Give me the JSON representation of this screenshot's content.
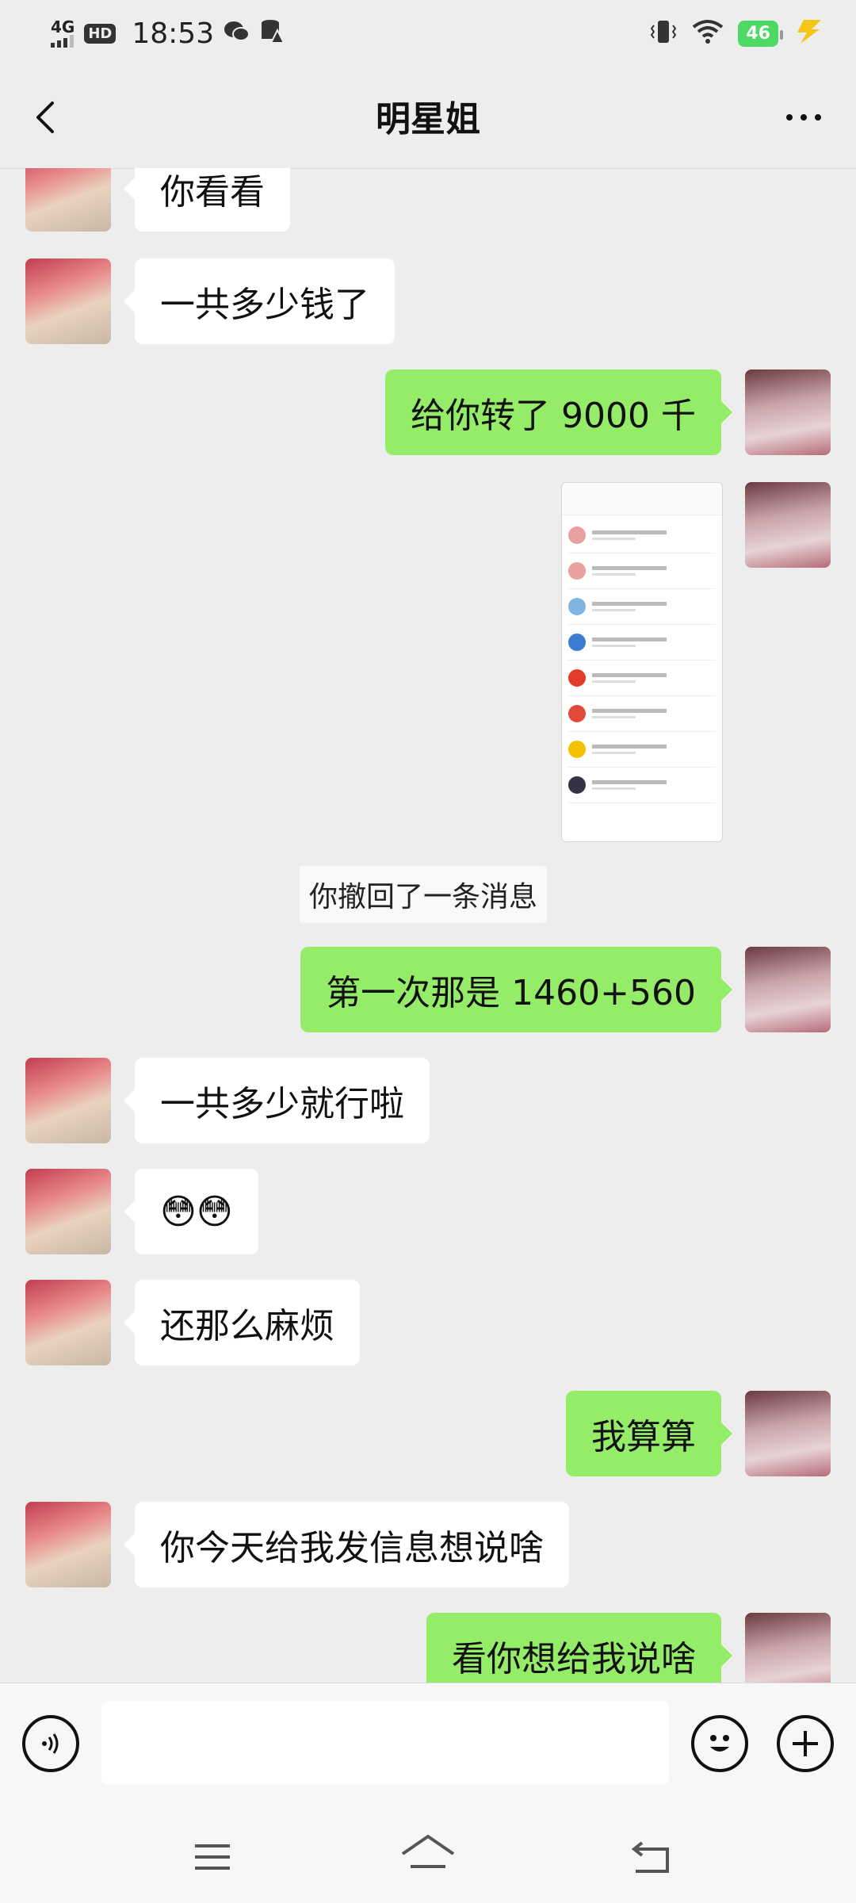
{
  "status_bar": {
    "network": "4G",
    "hd": "HD",
    "time": "18:53",
    "battery": "46",
    "icons": [
      "signal-icon",
      "wechat-icon",
      "storage-warning-icon",
      "vibrate-icon",
      "wifi-icon",
      "battery-icon",
      "charging-icon"
    ]
  },
  "header": {
    "title": "明星姐",
    "back_icon": "chevron-left-icon",
    "more_icon": "more-dots-icon"
  },
  "messages": [
    {
      "side": "left",
      "text": "你看看"
    },
    {
      "side": "left",
      "text": "一共多少钱了"
    },
    {
      "side": "right",
      "text": "给你转了 9000 千"
    },
    {
      "side": "right",
      "type": "image",
      "text": ""
    },
    {
      "type": "system",
      "text": "你撤回了一条消息"
    },
    {
      "side": "right",
      "text": "第一次那是 1460+560"
    },
    {
      "side": "left",
      "text": "一共多少就行啦"
    },
    {
      "side": "left",
      "text": "😳😳"
    },
    {
      "side": "left",
      "text": "还那么麻烦"
    },
    {
      "side": "right",
      "text": "我算算"
    },
    {
      "side": "left",
      "text": "你今天给我发信息想说啥"
    },
    {
      "side": "right",
      "text": "看你想给我说啥"
    }
  ],
  "input_bar": {
    "placeholder": "",
    "voice_icon": "voice-icon",
    "emoji_icon": "emoji-icon",
    "plus_icon": "plus-icon"
  },
  "system_nav": {
    "icons": [
      "menu-icon",
      "home-icon",
      "back-icon"
    ]
  },
  "colors": {
    "background": "#ededed",
    "my_bubble": "#95ec69",
    "their_bubble": "#ffffff",
    "battery": "#4cd964"
  }
}
